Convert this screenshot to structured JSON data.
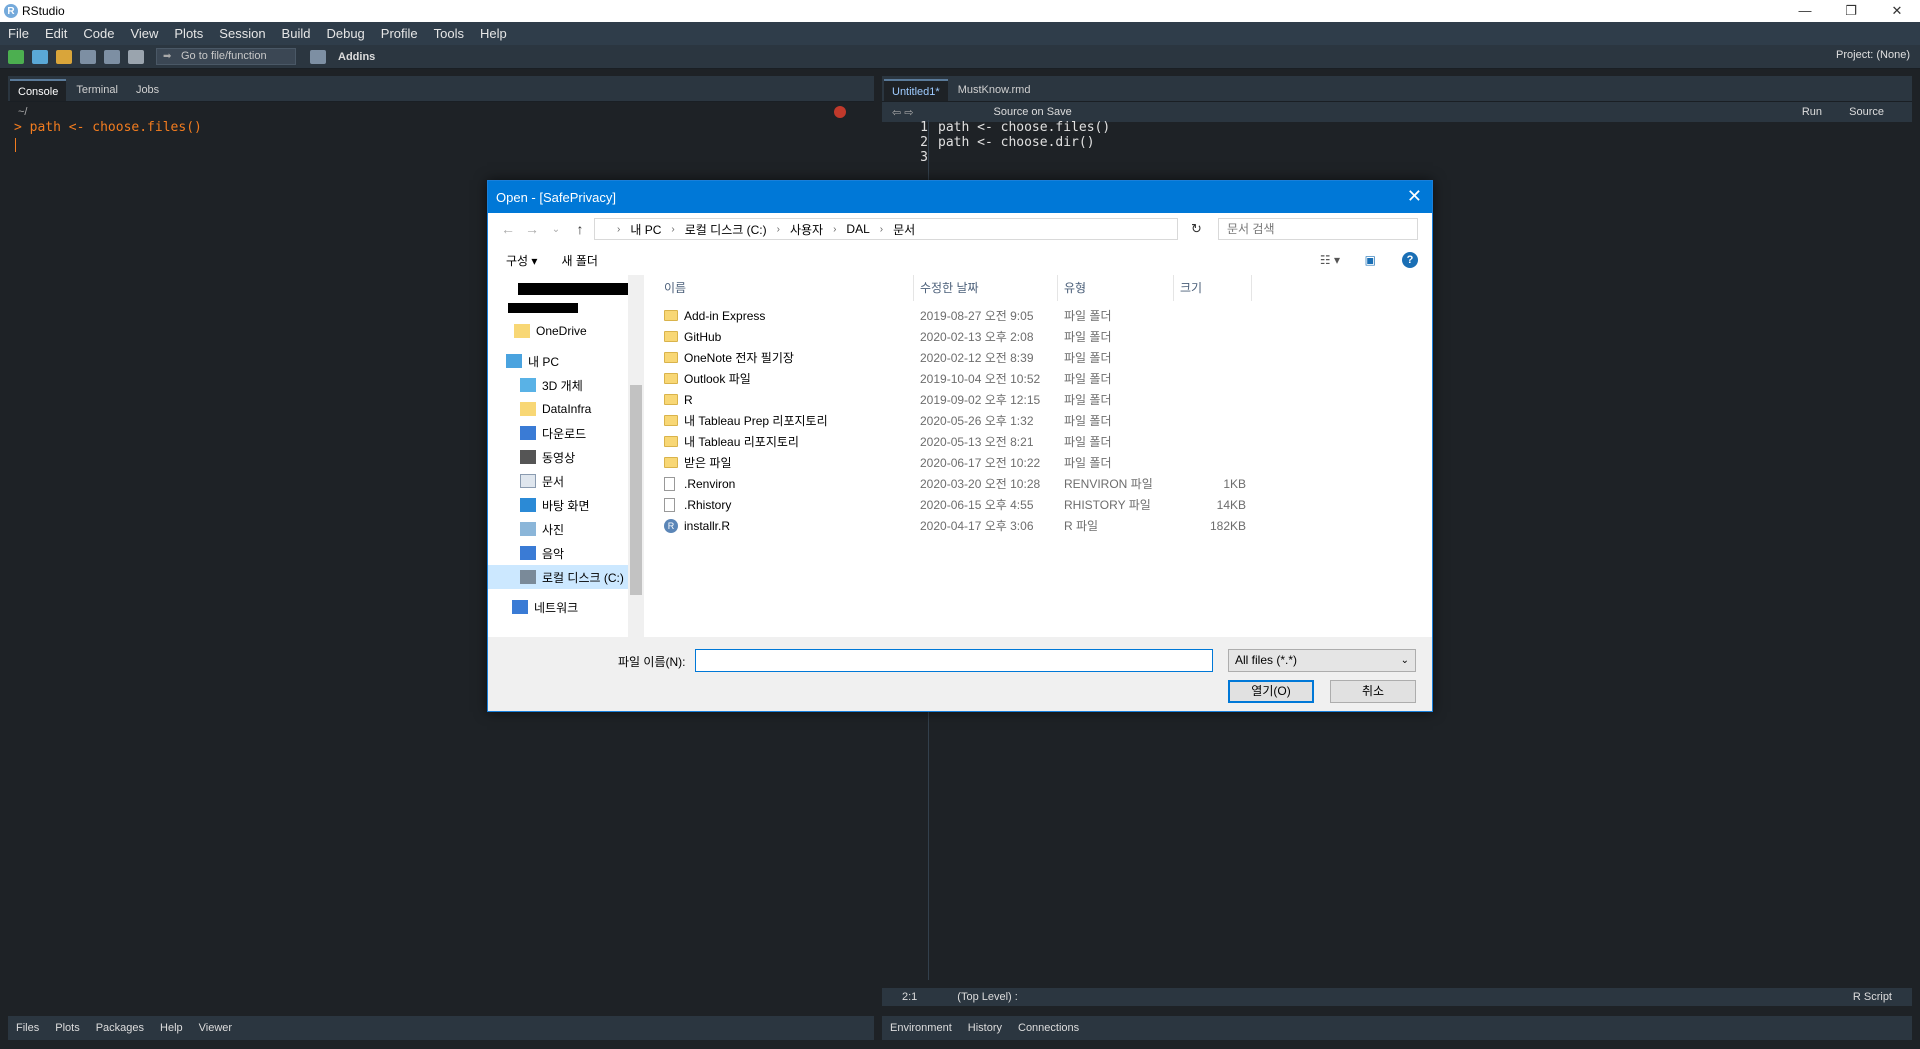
{
  "app": {
    "title": "RStudio"
  },
  "menu": [
    "File",
    "Edit",
    "Code",
    "View",
    "Plots",
    "Session",
    "Build",
    "Debug",
    "Profile",
    "Tools",
    "Help"
  ],
  "toolbar": {
    "goto_placeholder": "Go to file/function",
    "addins": "Addins",
    "project": "Project: (None)"
  },
  "left_tabs": [
    "Console",
    "Terminal",
    "Jobs"
  ],
  "console": {
    "path": "~/",
    "prompt": ">",
    "command": "path <- choose.files()"
  },
  "editor": {
    "tabs": [
      "Untitled1*",
      "MustKnow.rmd"
    ],
    "source_on_save": "Source on Save",
    "run": "Run",
    "source": "Source",
    "lines": [
      "path <- choose.files()",
      "path <- choose.dir()",
      ""
    ],
    "status_pos": "2:1",
    "status_scope": "(Top Level) :",
    "status_type": "R Script"
  },
  "bottom_left_tabs": [
    "Files",
    "Plots",
    "Packages",
    "Help",
    "Viewer"
  ],
  "bottom_right_tabs": [
    "Environment",
    "History",
    "Connections"
  ],
  "dialog": {
    "title": "Open - [SafePrivacy]",
    "breadcrumb": [
      "내 PC",
      "로컬 디스크 (C:)",
      "사용자",
      "DAL",
      "문서"
    ],
    "search_placeholder": "문서 검색",
    "organize": "구성 ▾",
    "new_folder": "새 폴더",
    "nav_items": [
      "OneDrive",
      "내 PC",
      "3D 개체",
      "DataInfra",
      "다운로드",
      "동영상",
      "문서",
      "바탕 화면",
      "사진",
      "음악",
      "로컬 디스크 (C:)",
      "네트워크"
    ],
    "columns": [
      "이름",
      "수정한 날짜",
      "유형",
      "크기"
    ],
    "files": [
      {
        "name": "Add-in Express",
        "date": "2019-08-27 오전 9:05",
        "type": "파일 폴더",
        "size": "",
        "kind": "folder"
      },
      {
        "name": "GitHub",
        "date": "2020-02-13 오후 2:08",
        "type": "파일 폴더",
        "size": "",
        "kind": "folder"
      },
      {
        "name": "OneNote 전자 필기장",
        "date": "2020-02-12 오전 8:39",
        "type": "파일 폴더",
        "size": "",
        "kind": "folder"
      },
      {
        "name": "Outlook 파일",
        "date": "2019-10-04 오전 10:52",
        "type": "파일 폴더",
        "size": "",
        "kind": "folder"
      },
      {
        "name": "R",
        "date": "2019-09-02 오후 12:15",
        "type": "파일 폴더",
        "size": "",
        "kind": "folder"
      },
      {
        "name": "내 Tableau Prep 리포지토리",
        "date": "2020-05-26 오후 1:32",
        "type": "파일 폴더",
        "size": "",
        "kind": "folder"
      },
      {
        "name": "내 Tableau 리포지토리",
        "date": "2020-05-13 오전 8:21",
        "type": "파일 폴더",
        "size": "",
        "kind": "folder"
      },
      {
        "name": "받은 파일",
        "date": "2020-06-17 오전 10:22",
        "type": "파일 폴더",
        "size": "",
        "kind": "folder"
      },
      {
        "name": ".Renviron",
        "date": "2020-03-20 오전 10:28",
        "type": "RENVIRON 파일",
        "size": "1KB",
        "kind": "doc"
      },
      {
        "name": ".Rhistory",
        "date": "2020-06-15 오후 4:55",
        "type": "RHISTORY 파일",
        "size": "14KB",
        "kind": "doc"
      },
      {
        "name": "installr.R",
        "date": "2020-04-17 오후 3:06",
        "type": "R 파일",
        "size": "182KB",
        "kind": "r"
      }
    ],
    "filename_label": "파일 이름(N):",
    "filename_value": "",
    "filter": "All files (*.*)",
    "open_button": "열기(O)",
    "cancel_button": "취소"
  }
}
